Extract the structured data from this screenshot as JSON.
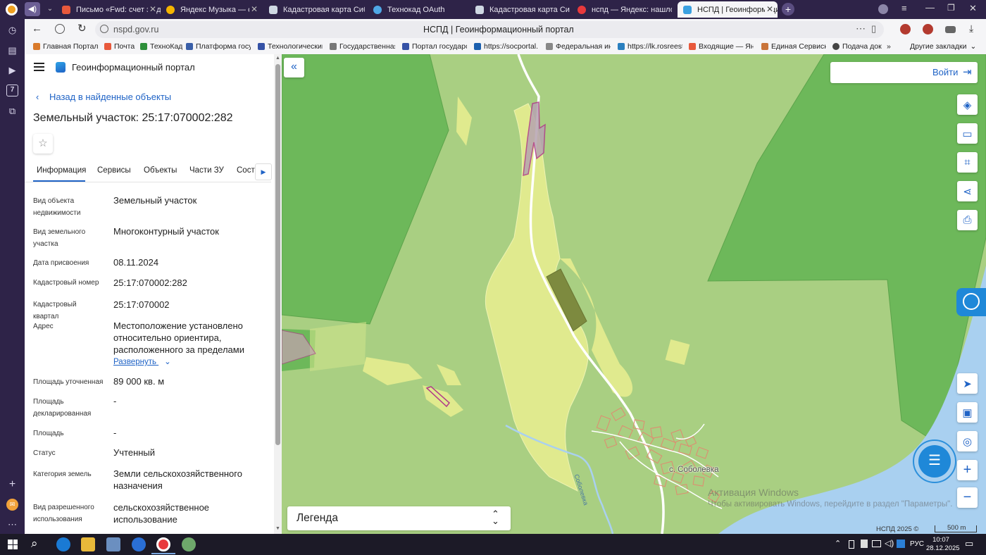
{
  "browser": {
    "tabs": [
      {
        "title": "",
        "icon": "speaker-icon"
      },
      {
        "title": "Письмо «Fwd: счет за де",
        "color": "#e8593c"
      },
      {
        "title": "Яндекс Музыка — с",
        "color": "#f5b400"
      },
      {
        "title": "Кадастровая карта Сибир",
        "color": "#cfd8e3"
      },
      {
        "title": "Технокад OAuth",
        "color": "#4fa7e6"
      },
      {
        "title": "Кадастровая карта Сибир",
        "color": "#cfd8e3"
      },
      {
        "title": "нспд — Яндекс: нашлось",
        "color": "#e8393c"
      },
      {
        "title": "НСПД | Геоинформаци",
        "color": "#3aa0e0"
      }
    ],
    "url": "nspd.gov.ru",
    "page_title": "НСПД | Геоинформационный портал",
    "bookmarks": [
      "Главная Портал З",
      "Почта",
      "ТехноКад",
      "Платформа госуд",
      "Технологический",
      "Государственная",
      "Портал государс",
      "https://socportal.",
      "Федеральная инф",
      "https://lk.rosreest",
      "Входящие — Янд",
      "Единая Сервисна",
      "Подача док"
    ],
    "other_bookmarks": "Другие закладки"
  },
  "panel": {
    "portal_title": "Геоинформационный портал",
    "back_link": "Назад в найденные объекты",
    "heading": "Земельный участок: 25:17:070002:282",
    "tabs": [
      "Информация",
      "Сервисы",
      "Объекты",
      "Части ЗУ",
      "Соста"
    ],
    "active_tab": "Информация",
    "fields": [
      {
        "label": "Вид объекта недвижимости",
        "value": "Земельный участок"
      },
      {
        "label": "Вид земельного участка",
        "value": "Многоконтурный участок"
      },
      {
        "label": "Дата присвоения",
        "value": "08.11.2024"
      },
      {
        "label": "Кадастровый номер",
        "value": "25:17:070002:282"
      },
      {
        "label": "Кадастровый квартал",
        "value": "25:17:070002"
      },
      {
        "label": "Адрес",
        "value": "Местоположение установлено относительно ориентира, расположенного за пределами"
      },
      {
        "label": "Площадь уточненная",
        "value": "89 000 кв. м"
      },
      {
        "label": "Площадь декларированная",
        "value": "-"
      },
      {
        "label": "Площадь",
        "value": "-"
      },
      {
        "label": "Статус",
        "value": "Учтенный"
      },
      {
        "label": "Категория земель",
        "value": "Земли сельскохозяйственного назначения"
      },
      {
        "label": "Вид разрешенного использования",
        "value": "сельскохозяйственное использование"
      }
    ],
    "expand_link": "Развернуть"
  },
  "map": {
    "login_label": "Войти",
    "legend_label": "Легенда",
    "village_label": "с. Соболевка",
    "river_label": "Соболевка",
    "attribution": "НСПД 2025 ©",
    "scale_label": "500 m",
    "watermark_line1": "Активация Windows",
    "watermark_line2": "Чтобы активировать Windows, перейдите в раздел \"Параметры\".",
    "colors": {
      "forest": "#6db85a",
      "meadow": "#a9cf82",
      "agri": "#e0ea8e",
      "water": "#a9d0f0",
      "parcel_selected": "#7d8a3f",
      "parcel_outline": "#b03a8a",
      "building": "#e08a70",
      "accent": "#1f63c6"
    }
  },
  "taskbar": {
    "lang": "РУС",
    "time": "10:07",
    "date": "28.12.2025"
  }
}
